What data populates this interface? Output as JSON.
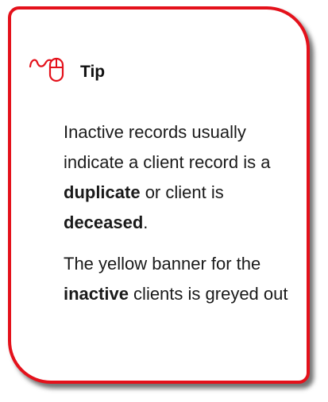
{
  "tip": {
    "title": "Tip",
    "icon": "computer-mouse-icon",
    "accent_color": "#e4111b",
    "paragraph1": {
      "text1": "Inactive records usually indicate a client record is a ",
      "bold1": "duplicate",
      "text2": " or client is ",
      "bold2": "deceased",
      "text3": "."
    },
    "paragraph2": {
      "text1": "The yellow banner for the ",
      "bold1": "inactive",
      "text2": " clients is greyed out"
    }
  }
}
